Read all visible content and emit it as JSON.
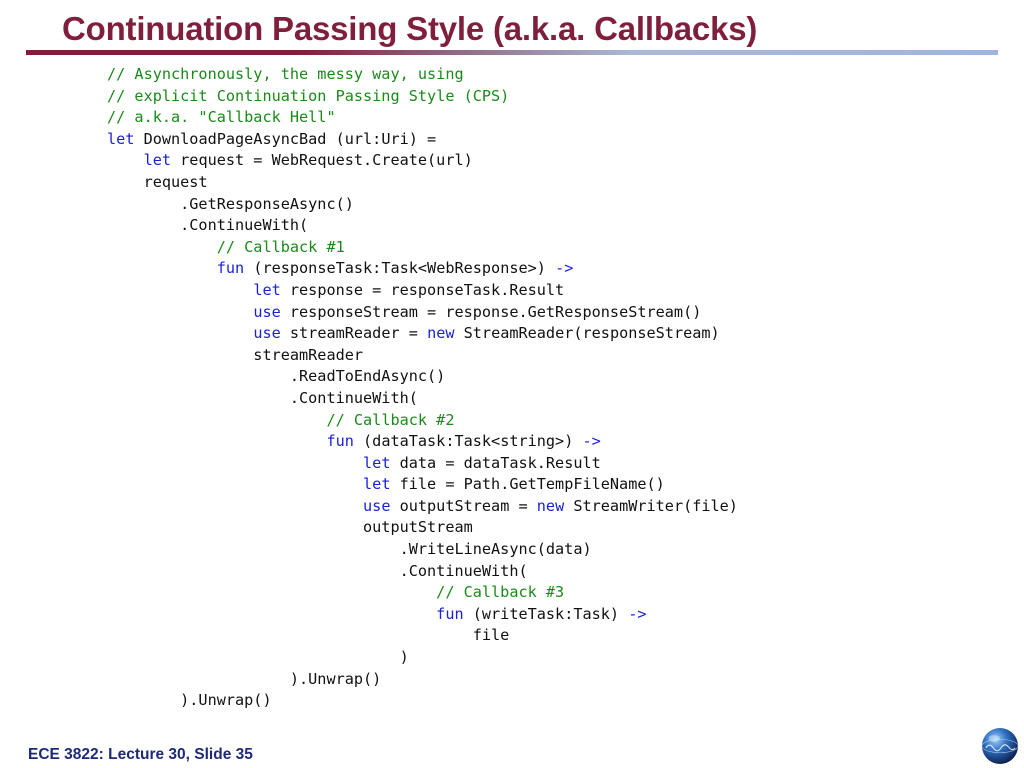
{
  "slide": {
    "title": "Continuation Passing Style (a.k.a. Callbacks)",
    "footer": "ECE 3822: Lecture 30, Slide 35"
  },
  "colors": {
    "title": "#7f1f3b",
    "comment": "#1a8a1a",
    "keyword": "#1a22d6",
    "code": "#111111",
    "footer": "#1e2a78"
  },
  "code": {
    "lines": [
      [
        {
          "t": "comment",
          "s": "// Asynchronously, the messy way, using"
        }
      ],
      [
        {
          "t": "comment",
          "s": "// explicit Continuation Passing Style (CPS)"
        }
      ],
      [
        {
          "t": "comment",
          "s": "// a.k.a. \"Callback Hell\""
        }
      ],
      [
        {
          "t": "keyword",
          "s": "let"
        },
        {
          "t": "plain",
          "s": " DownloadPageAsyncBad (url:Uri) ="
        }
      ],
      [
        {
          "t": "plain",
          "s": "    "
        },
        {
          "t": "keyword",
          "s": "let"
        },
        {
          "t": "plain",
          "s": " request = WebRequest.Create(url)"
        }
      ],
      [
        {
          "t": "plain",
          "s": "    request"
        }
      ],
      [
        {
          "t": "plain",
          "s": "        .GetResponseAsync()"
        }
      ],
      [
        {
          "t": "plain",
          "s": "        .ContinueWith("
        }
      ],
      [
        {
          "t": "plain",
          "s": "            "
        },
        {
          "t": "comment",
          "s": "// Callback #1"
        }
      ],
      [
        {
          "t": "plain",
          "s": "            "
        },
        {
          "t": "keyword",
          "s": "fun"
        },
        {
          "t": "plain",
          "s": " (responseTask:Task<WebResponse>) "
        },
        {
          "t": "keyword",
          "s": "->"
        }
      ],
      [
        {
          "t": "plain",
          "s": "                "
        },
        {
          "t": "keyword",
          "s": "let"
        },
        {
          "t": "plain",
          "s": " response = responseTask.Result"
        }
      ],
      [
        {
          "t": "plain",
          "s": "                "
        },
        {
          "t": "keyword",
          "s": "use"
        },
        {
          "t": "plain",
          "s": " responseStream = response.GetResponseStream()"
        }
      ],
      [
        {
          "t": "plain",
          "s": "                "
        },
        {
          "t": "keyword",
          "s": "use"
        },
        {
          "t": "plain",
          "s": " streamReader = "
        },
        {
          "t": "keyword",
          "s": "new"
        },
        {
          "t": "plain",
          "s": " StreamReader(responseStream)"
        }
      ],
      [
        {
          "t": "plain",
          "s": "                streamReader"
        }
      ],
      [
        {
          "t": "plain",
          "s": "                    .ReadToEndAsync()"
        }
      ],
      [
        {
          "t": "plain",
          "s": "                    .ContinueWith("
        }
      ],
      [
        {
          "t": "plain",
          "s": "                        "
        },
        {
          "t": "comment",
          "s": "// Callback #2"
        }
      ],
      [
        {
          "t": "plain",
          "s": "                        "
        },
        {
          "t": "keyword",
          "s": "fun"
        },
        {
          "t": "plain",
          "s": " (dataTask:Task<string>) "
        },
        {
          "t": "keyword",
          "s": "->"
        }
      ],
      [
        {
          "t": "plain",
          "s": "                            "
        },
        {
          "t": "keyword",
          "s": "let"
        },
        {
          "t": "plain",
          "s": " data = dataTask.Result"
        }
      ],
      [
        {
          "t": "plain",
          "s": "                            "
        },
        {
          "t": "keyword",
          "s": "let"
        },
        {
          "t": "plain",
          "s": " file = Path.GetTempFileName()"
        }
      ],
      [
        {
          "t": "plain",
          "s": "                            "
        },
        {
          "t": "keyword",
          "s": "use"
        },
        {
          "t": "plain",
          "s": " outputStream = "
        },
        {
          "t": "keyword",
          "s": "new"
        },
        {
          "t": "plain",
          "s": " StreamWriter(file)"
        }
      ],
      [
        {
          "t": "plain",
          "s": "                            outputStream"
        }
      ],
      [
        {
          "t": "plain",
          "s": "                                .WriteLineAsync(data)"
        }
      ],
      [
        {
          "t": "plain",
          "s": "                                .ContinueWith("
        }
      ],
      [
        {
          "t": "plain",
          "s": "                                    "
        },
        {
          "t": "comment",
          "s": "// Callback #3"
        }
      ],
      [
        {
          "t": "plain",
          "s": "                                    "
        },
        {
          "t": "keyword",
          "s": "fun"
        },
        {
          "t": "plain",
          "s": " (writeTask:Task) "
        },
        {
          "t": "keyword",
          "s": "->"
        }
      ],
      [
        {
          "t": "plain",
          "s": "                                        file"
        }
      ],
      [
        {
          "t": "plain",
          "s": "                                )"
        }
      ],
      [
        {
          "t": "plain",
          "s": "                    ).Unwrap()"
        }
      ],
      [
        {
          "t": "plain",
          "s": "        ).Unwrap()"
        }
      ]
    ]
  },
  "logo": {
    "icon": "globe-logo-icon"
  }
}
